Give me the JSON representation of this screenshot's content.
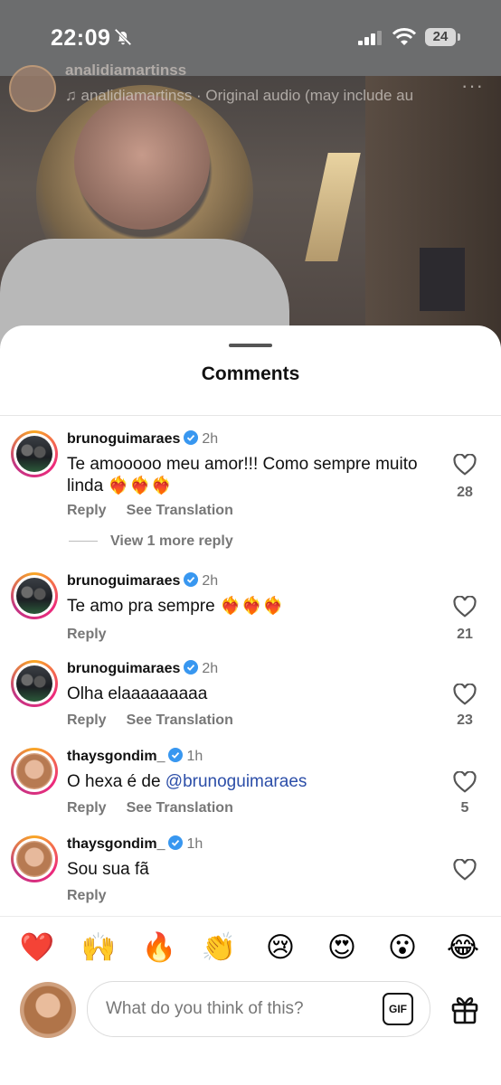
{
  "status_bar": {
    "time": "22:09",
    "battery": "24"
  },
  "video": {
    "username": "analidiamartinss",
    "audio": "analidiamartinss · Original audio (may include au",
    "more": "···"
  },
  "sheet": {
    "title": "Comments"
  },
  "comments": [
    {
      "username": "brunoguimaraes",
      "time": "2h",
      "text": "Te amooooo meu amor!!! Como sempre muito linda ❤️‍🔥❤️‍🔥❤️‍🔥",
      "reply": "Reply",
      "translate": "See Translation",
      "likes": "28",
      "more_replies": "View 1 more reply"
    },
    {
      "username": "brunoguimaraes",
      "time": "2h",
      "text": "Te amo pra sempre ❤️‍🔥❤️‍🔥❤️‍🔥",
      "reply": "Reply",
      "likes": "21"
    },
    {
      "username": "brunoguimaraes",
      "time": "2h",
      "text": "Olha elaaaaaaaaa",
      "reply": "Reply",
      "translate": "See Translation",
      "likes": "23"
    },
    {
      "username": "thaysgondim_",
      "time": "1h",
      "text_prefix": "O hexa é de ",
      "mention": "@brunoguimaraes",
      "reply": "Reply",
      "translate": "See Translation",
      "likes": "5"
    },
    {
      "username": "thaysgondim_",
      "time": "1h",
      "text": "Sou sua fã",
      "reply": "Reply"
    }
  ],
  "reactions": [
    "❤️",
    "🙌",
    "🔥",
    "👏",
    "😢",
    "😍",
    "😮",
    "😂"
  ],
  "composer": {
    "placeholder": "What do you think of this?",
    "gif_label": "GIF"
  },
  "colors": {
    "mention": "#2c4ea8",
    "verified": "#3897f0"
  },
  "icons": [
    "bell-slash-icon",
    "signal-icon",
    "wifi-icon",
    "music-note-icon",
    "verified-icon",
    "heart-icon",
    "gift-icon"
  ]
}
